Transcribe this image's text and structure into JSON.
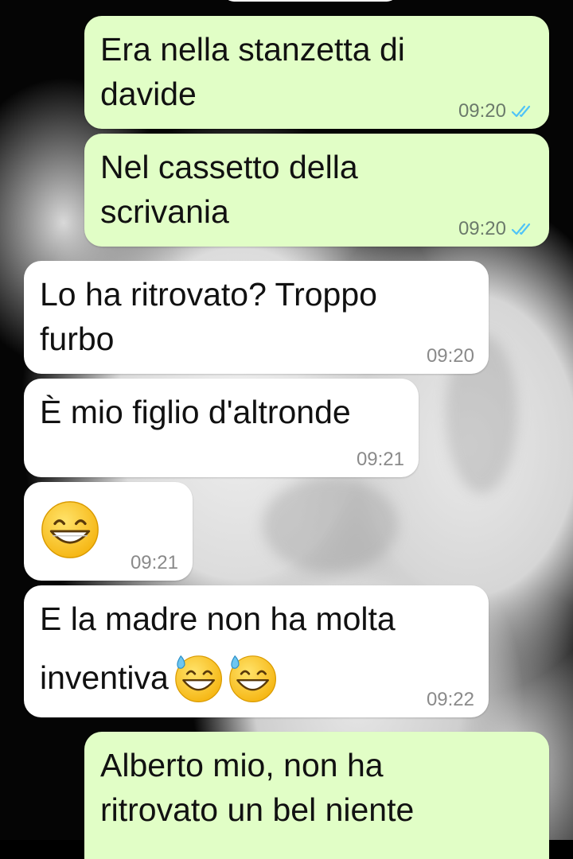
{
  "chat": {
    "messages": [
      {
        "direction": "outgoing",
        "lines": [
          "Era nella stanzetta di",
          "davide"
        ],
        "time": "09:20",
        "status": "read-double-tick"
      },
      {
        "direction": "outgoing",
        "lines": [
          "Nel cassetto della",
          "scrivania"
        ],
        "time": "09:20",
        "status": "read-double-tick"
      },
      {
        "direction": "incoming",
        "lines": [
          "Lo ha ritrovato? Troppo",
          "furbo"
        ],
        "time": "09:20"
      },
      {
        "direction": "incoming",
        "lines": [
          "È mio figlio d'altronde"
        ],
        "time": "09:21"
      },
      {
        "direction": "incoming",
        "emoji": "grinning-face-emoji",
        "time": "09:21"
      },
      {
        "direction": "incoming",
        "lines": [
          "E la madre non ha molta",
          "inventiva"
        ],
        "emoji_trailing": [
          "grinning-sweat-emoji",
          "grinning-sweat-emoji"
        ],
        "time": "09:22"
      },
      {
        "direction": "outgoing",
        "lines": [
          "Alberto mio, non ha",
          "ritrovato un bel niente"
        ]
      }
    ]
  },
  "colors": {
    "outgoing_bubble": "#e1fec6",
    "incoming_bubble": "#ffffff",
    "read_tick": "#4fc3f7",
    "wallpaper_dark": "#050505"
  }
}
